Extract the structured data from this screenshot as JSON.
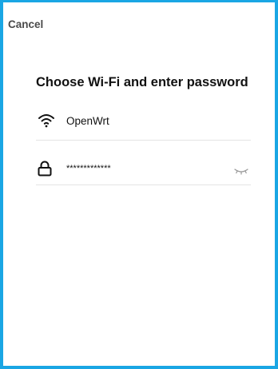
{
  "header": {
    "cancel_label": "Cancel"
  },
  "page": {
    "title": "Choose Wi-Fi and enter password"
  },
  "network": {
    "ssid": "OpenWrt",
    "icon": "wifi-icon"
  },
  "password": {
    "masked_value": "*************",
    "icon": "lock-icon",
    "toggle_icon": "eye-closed-icon"
  },
  "colors": {
    "frame_border": "#1aa6e4",
    "divider": "#e4e4e4"
  }
}
